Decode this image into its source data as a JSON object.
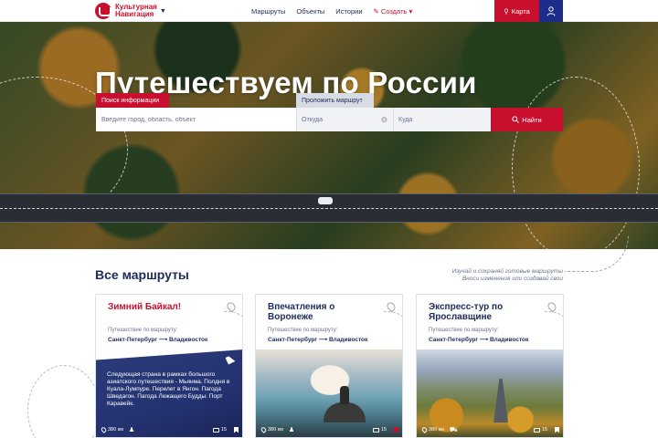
{
  "header": {
    "logo_line1": "Культурная",
    "logo_line2": "Навигация",
    "nav": [
      "Маршруты",
      "Объекты",
      "Истории"
    ],
    "create_label": "Создать",
    "map_label": "Карта"
  },
  "hero": {
    "title": "Путешествуем по России",
    "tab_search": "Поиск информации",
    "tab_route": "Проложить маршрут",
    "city_placeholder": "Введите город, область, объект",
    "from_placeholder": "Откуда",
    "to_placeholder": "Куда",
    "find_label": "Найти"
  },
  "section": {
    "title": "Все маршруты",
    "note_line1": "Изучай и сохраняй готовые маршруты",
    "note_line2": "Вноси изменения или создавай свои"
  },
  "cards": [
    {
      "title": "Зимний Байкал!",
      "subtitle": "Путешествие по маршруту:",
      "route_from": "Санкт-Петербург",
      "route_to": "Владивосток",
      "description": "Следующая страна в рамках большого азиатского путешествия - Мьянма. Полдня в Куала-Лумпуре. Перелет в Янгон. Пагода Шведагон. Пагода Лежащего Будды. Порт Каравейк.",
      "distance": "380 км",
      "comments": "15",
      "title_color": "#c8102e"
    },
    {
      "title": "Впечатления о Воронеже",
      "subtitle": "Путешествие по маршруту:",
      "route_from": "Санкт-Петербург",
      "route_to": "Владивосток",
      "distance": "380 км",
      "comments": "15",
      "title_color": "#1d2b5a"
    },
    {
      "title": "Экспресс-тур по Ярославщине",
      "subtitle": "Путешествие по маршруту:",
      "route_from": "Санкт-Петербург",
      "route_to": "Владивосток",
      "distance": "380 км",
      "comments": "15",
      "title_color": "#1d2b5a"
    }
  ],
  "colors": {
    "accent": "#c8102e",
    "navy": "#1d2b5a",
    "user_button": "#1d2b8a"
  },
  "icons": [
    "logo-icon",
    "chevron-down-icon",
    "pencil-icon",
    "map-pin-icon",
    "user-icon",
    "swap-icon",
    "search-icon",
    "bookmark-icon",
    "comment-icon",
    "walker-icon",
    "car-icon"
  ]
}
